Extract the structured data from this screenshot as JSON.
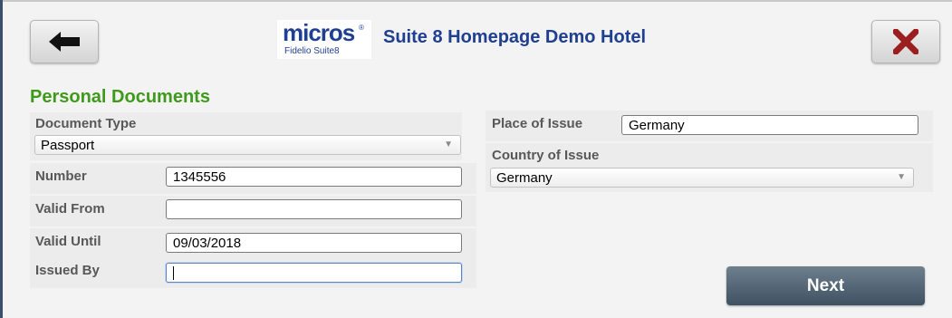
{
  "header": {
    "logo_text": "micros",
    "logo_registered": "®",
    "logo_subtext": "Fidelio Suite8",
    "title": "Suite 8 Homepage Demo Hotel",
    "back_icon": "arrow-left-icon",
    "close_icon": "close-x-icon"
  },
  "section": {
    "title": "Personal Documents"
  },
  "form": {
    "document_type": {
      "label": "Document Type",
      "value": "Passport"
    },
    "number": {
      "label": "Number",
      "value": "1345556"
    },
    "valid_from": {
      "label": "Valid From",
      "value": ""
    },
    "valid_until": {
      "label": "Valid Until",
      "value": "09/03/2018"
    },
    "issued_by": {
      "label": "Issued By",
      "value": ""
    },
    "place_of_issue": {
      "label": "Place of Issue",
      "value": "Germany"
    },
    "country_of_issue": {
      "label": "Country of Issue",
      "value": "Germany"
    }
  },
  "actions": {
    "next_label": "Next"
  },
  "colors": {
    "brand_blue": "#1f3f91",
    "section_green": "#3f9a1c",
    "close_red": "#9b1f1f",
    "next_button": "#4f6172"
  }
}
